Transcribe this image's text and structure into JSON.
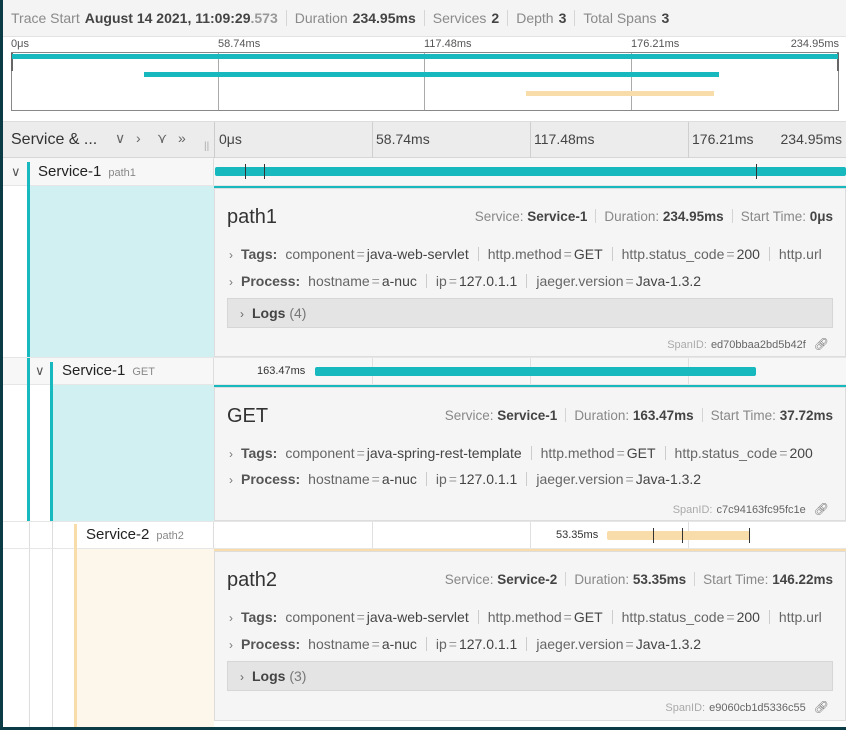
{
  "header": {
    "trace_start_label": "Trace Start",
    "trace_start_value": "August 14 2021, 11:09:29",
    "trace_start_ms": ".573",
    "duration_label": "Duration",
    "duration_value": "234.95ms",
    "services_label": "Services",
    "services_value": "2",
    "depth_label": "Depth",
    "depth_value": "3",
    "total_spans_label": "Total Spans",
    "total_spans_value": "3"
  },
  "ticks": [
    "0μs",
    "58.74ms",
    "117.48ms",
    "176.21ms",
    "234.95ms"
  ],
  "columns": {
    "service_header": "Service & ...",
    "collapse_one_icon": "chevron-down-icon",
    "expand_one_icon": "chevron-right-icon",
    "collapse_all_icon": "double-chevron-down-icon",
    "expand_all_icon": "double-chevron-right-icon"
  },
  "colors": {
    "service_1": "#17b8be",
    "service_1_light": "#d0f0f1",
    "service_2": "#f8dcaa",
    "service_2_light": "#fdf6ea",
    "service_2_bar": "#e8c68b"
  },
  "spans": [
    {
      "service": "Service-1",
      "operation": "path1",
      "duration_label": "",
      "detail": {
        "title": "path1",
        "service_label": "Service:",
        "service_value": "Service-1",
        "duration_label": "Duration:",
        "duration_value": "234.95ms",
        "start_label": "Start Time:",
        "start_value": "0μs",
        "tags_label": "Tags:",
        "tags": [
          {
            "k": "component",
            "v": "java-web-servlet"
          },
          {
            "k": "http.method",
            "v": "GET"
          },
          {
            "k": "http.status_code",
            "v": "200"
          },
          {
            "k": "http.url",
            "v": ""
          }
        ],
        "process_label": "Process:",
        "process": [
          {
            "k": "hostname",
            "v": "a-nuc"
          },
          {
            "k": "ip",
            "v": "127.0.1.1"
          },
          {
            "k": "jaeger.version",
            "v": "Java-1.3.2"
          }
        ],
        "logs_label": "Logs",
        "logs_count": "(4)",
        "span_id_label": "SpanID:",
        "span_id": "ed70bbaa2bd5b42f"
      }
    },
    {
      "service": "Service-1",
      "operation": "GET",
      "duration_label": "163.47ms",
      "detail": {
        "title": "GET",
        "service_label": "Service:",
        "service_value": "Service-1",
        "duration_label": "Duration:",
        "duration_value": "163.47ms",
        "start_label": "Start Time:",
        "start_value": "37.72ms",
        "tags_label": "Tags:",
        "tags": [
          {
            "k": "component",
            "v": "java-spring-rest-template"
          },
          {
            "k": "http.method",
            "v": "GET"
          },
          {
            "k": "http.status_code",
            "v": "200"
          }
        ],
        "process_label": "Process:",
        "process": [
          {
            "k": "hostname",
            "v": "a-nuc"
          },
          {
            "k": "ip",
            "v": "127.0.1.1"
          },
          {
            "k": "jaeger.version",
            "v": "Java-1.3.2"
          }
        ],
        "span_id_label": "SpanID:",
        "span_id": "c7c94163fc95fc1e"
      }
    },
    {
      "service": "Service-2",
      "operation": "path2",
      "duration_label": "53.35ms",
      "detail": {
        "title": "path2",
        "service_label": "Service:",
        "service_value": "Service-2",
        "duration_label": "Duration:",
        "duration_value": "53.35ms",
        "start_label": "Start Time:",
        "start_value": "146.22ms",
        "tags_label": "Tags:",
        "tags": [
          {
            "k": "component",
            "v": "java-web-servlet"
          },
          {
            "k": "http.method",
            "v": "GET"
          },
          {
            "k": "http.status_code",
            "v": "200"
          },
          {
            "k": "http.url",
            "v": ""
          }
        ],
        "process_label": "Process:",
        "process": [
          {
            "k": "hostname",
            "v": "a-nuc"
          },
          {
            "k": "ip",
            "v": "127.0.1.1"
          },
          {
            "k": "jaeger.version",
            "v": "Java-1.3.2"
          }
        ],
        "logs_label": "Logs",
        "logs_count": "(3)",
        "span_id_label": "SpanID:",
        "span_id": "e9060cb1d5336c55"
      }
    }
  ]
}
